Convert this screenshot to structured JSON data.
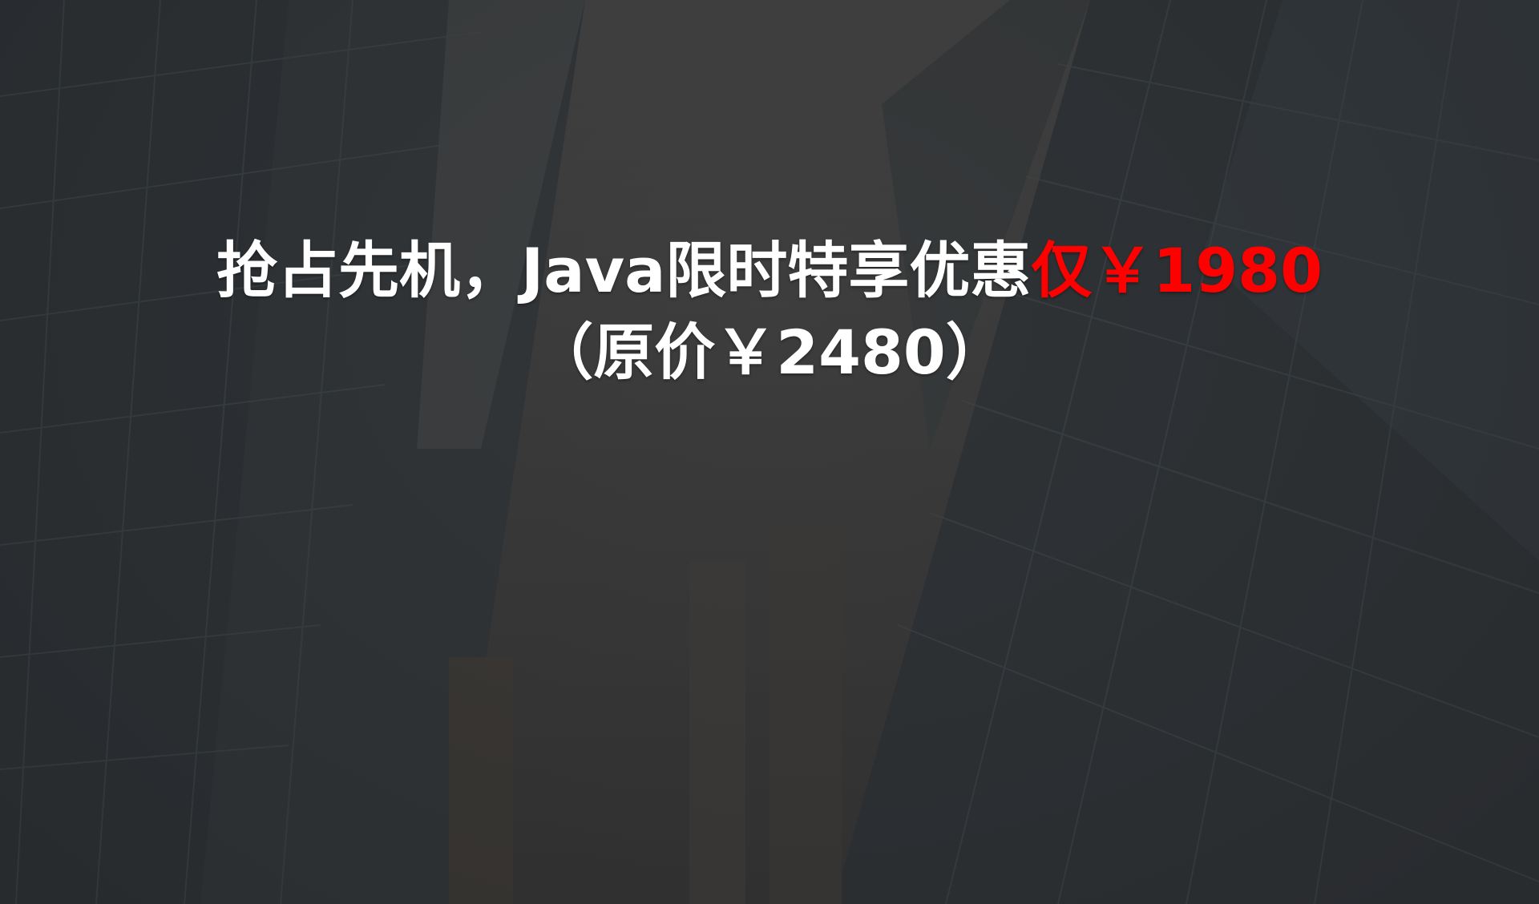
{
  "slide": {
    "headline_main": "抢占先机，Java限时特享优惠",
    "headline_accent": "仅￥1980",
    "subline": "（原价￥2480）"
  },
  "colors": {
    "text": "#ffffff",
    "accent": "#ff0000",
    "background": "#3a3a3a"
  },
  "background_image": "skyscrapers-looking-up-photo"
}
